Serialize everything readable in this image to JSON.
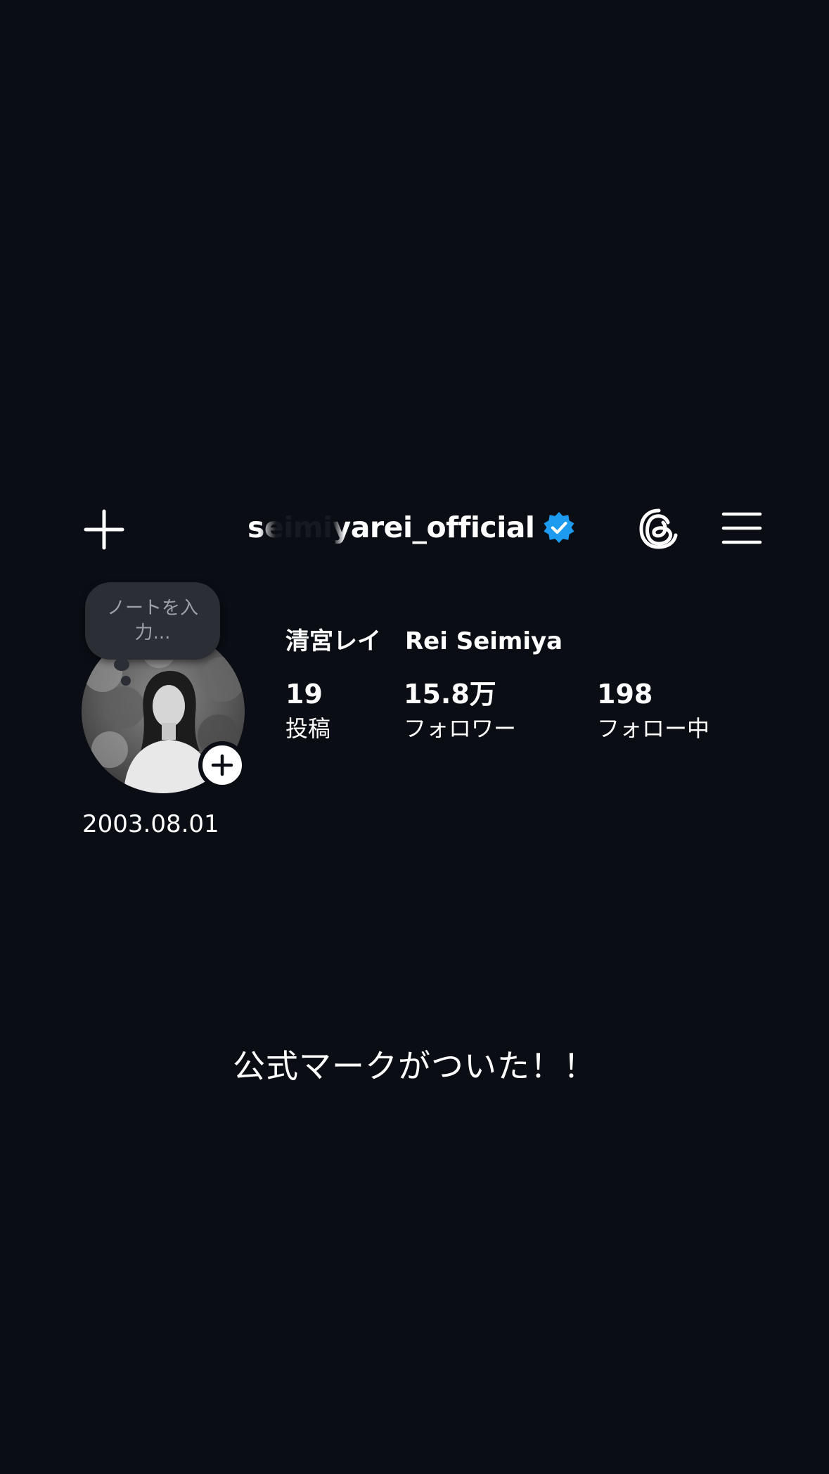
{
  "header": {
    "username": "seimiyarei_official",
    "verified": true,
    "verified_color": "#1d9bf0",
    "icons": [
      "plus-icon",
      "verified-icon",
      "threads-icon",
      "menu-icon"
    ]
  },
  "profile": {
    "note_placeholder": "ノートを入力...",
    "display_name": "清宮レイ　Rei Seimiya",
    "stats": {
      "posts": {
        "value": "19",
        "label": "投稿"
      },
      "followers": {
        "value": "15.8万",
        "label": "フォロワー"
      },
      "following": {
        "value": "198",
        "label": "フォロー中"
      }
    },
    "bio": "2003.08.01"
  },
  "caption": "公式マークがついた！！",
  "colors": {
    "background": "#0a0d14",
    "note_bubble": "#2b2e35",
    "text": "#ffffff"
  }
}
